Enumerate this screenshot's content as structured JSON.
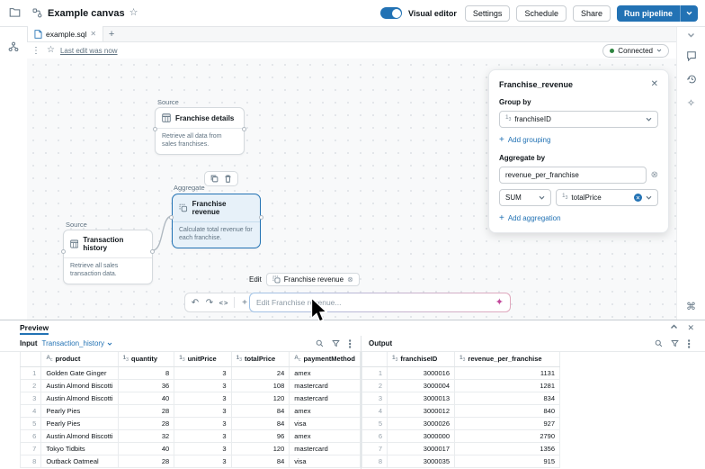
{
  "topbar": {
    "title": "Example canvas",
    "visual_editor_label": "Visual editor",
    "settings_label": "Settings",
    "schedule_label": "Schedule",
    "share_label": "Share",
    "run_pipeline_label": "Run pipeline"
  },
  "tabbar": {
    "tab_label": "example.sql"
  },
  "statusbar": {
    "last_edit": "Last edit was now",
    "connected_label": "Connected"
  },
  "canvas": {
    "nodes": {
      "franchise_details": {
        "type_label": "Source",
        "title": "Franchise details",
        "description": "Retrieve all data from sales franchises."
      },
      "franchise_revenue": {
        "type_label": "Aggregate",
        "title": "Franchise revenue",
        "description": "Calculate total revenue for each franchise."
      },
      "transaction_history": {
        "type_label": "Source",
        "title": "Transaction history",
        "description": "Retrieve all sales transaction data."
      }
    },
    "edit_bar": {
      "edit_label": "Edit",
      "chip_label": "Franchise revenue",
      "placeholder": "Edit Franchise revenue..."
    }
  },
  "panel": {
    "title": "Franchise_revenue",
    "group_by_label": "Group by",
    "group_by_value": "franchiseID",
    "add_grouping_label": "Add grouping",
    "aggregate_by_label": "Aggregate by",
    "aggregate_name_value": "revenue_per_franchise",
    "agg_function_value": "SUM",
    "agg_column_value": "totalPrice",
    "add_aggregation_label": "Add aggregation"
  },
  "preview": {
    "tab_label": "Preview",
    "input_label": "Input",
    "input_source": "Transaction_history",
    "output_label": "Output",
    "input_table": {
      "columns": [
        {
          "name": "product",
          "type": "str"
        },
        {
          "name": "quantity",
          "type": "num"
        },
        {
          "name": "unitPrice",
          "type": "num"
        },
        {
          "name": "totalPrice",
          "type": "num"
        },
        {
          "name": "paymentMethod",
          "type": "str"
        }
      ],
      "rows": [
        [
          "Golden Gate Ginger",
          8,
          3,
          24,
          "amex"
        ],
        [
          "Austin Almond Biscotti",
          36,
          3,
          108,
          "mastercard"
        ],
        [
          "Austin Almond Biscotti",
          40,
          3,
          120,
          "mastercard"
        ],
        [
          "Pearly Pies",
          28,
          3,
          84,
          "amex"
        ],
        [
          "Pearly Pies",
          28,
          3,
          84,
          "visa"
        ],
        [
          "Austin Almond Biscotti",
          32,
          3,
          96,
          "amex"
        ],
        [
          "Tokyo Tidbits",
          40,
          3,
          120,
          "mastercard"
        ],
        [
          "Outback Oatmeal",
          28,
          3,
          84,
          "visa"
        ]
      ]
    },
    "output_table": {
      "columns": [
        {
          "name": "franchiseID",
          "type": "num"
        },
        {
          "name": "revenue_per_franchise",
          "type": "num"
        }
      ],
      "rows": [
        [
          3000016,
          1131
        ],
        [
          3000004,
          1281
        ],
        [
          3000013,
          834
        ],
        [
          3000012,
          840
        ],
        [
          3000026,
          927
        ],
        [
          3000000,
          2790
        ],
        [
          3000017,
          1356
        ],
        [
          3000035,
          915
        ]
      ]
    }
  },
  "colors": {
    "accent": "#2272B4",
    "connected_green": "#2E8540",
    "selected_node_bg": "#E7F1F9",
    "sparkle": "#C2479B"
  }
}
